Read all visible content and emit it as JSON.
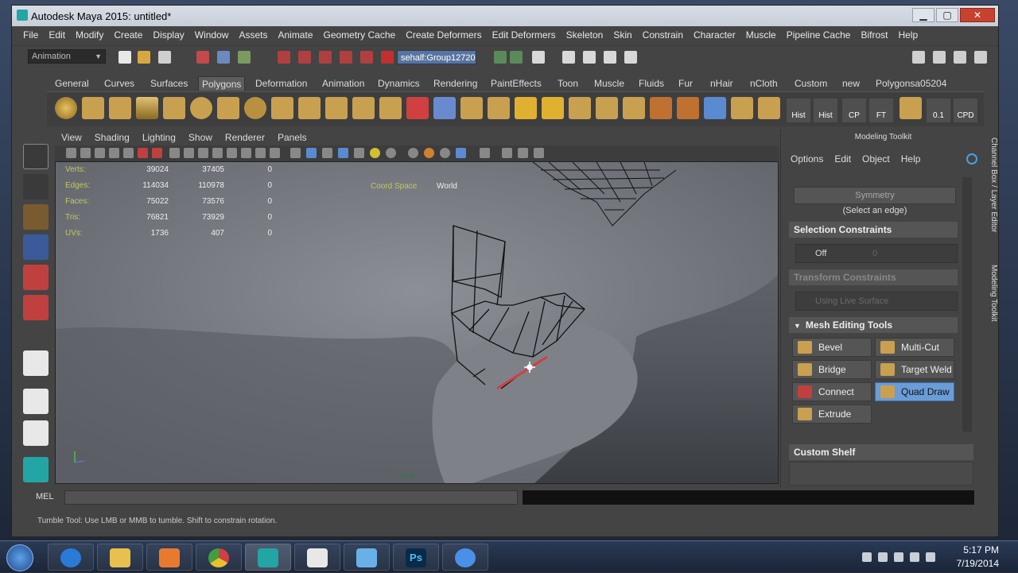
{
  "window": {
    "title": "Autodesk Maya 2015: untitled*",
    "min_label": "▁",
    "max_label": "▢",
    "close_label": "✕"
  },
  "menubar": [
    "File",
    "Edit",
    "Modify",
    "Create",
    "Display",
    "Window",
    "Assets",
    "Animate",
    "Geometry Cache",
    "Create Deformers",
    "Edit Deformers",
    "Skeleton",
    "Skin",
    "Constrain",
    "Character",
    "Muscle",
    "Pipeline Cache",
    "Bifrost",
    "Help"
  ],
  "statusline": {
    "mode": "Animation",
    "selection_field": "sehalf:Group12720"
  },
  "shelf_tabs": [
    "General",
    "Curves",
    "Surfaces",
    "Polygons",
    "Deformation",
    "Animation",
    "Dynamics",
    "Rendering",
    "PaintEffects",
    "Toon",
    "Muscle",
    "Fluids",
    "Fur",
    "nHair",
    "nCloth",
    "Custom",
    "new",
    "Polygonsa05204"
  ],
  "active_shelf_tab": "Polygons",
  "shelf_labels": [
    "Hist",
    "Hist",
    "CP",
    "FT",
    "0.1",
    "CPD"
  ],
  "panel_menu": [
    "View",
    "Shading",
    "Lighting",
    "Show",
    "Renderer",
    "Panels"
  ],
  "hud": {
    "rows": [
      {
        "label": "Verts:",
        "v1": "39024",
        "v2": "37405",
        "v3": "0"
      },
      {
        "label": "Edges:",
        "v1": "114034",
        "v2": "110978",
        "v3": "0"
      },
      {
        "label": "Faces:",
        "v1": "75022",
        "v2": "73576",
        "v3": "0"
      },
      {
        "label": "Tris:",
        "v1": "76821",
        "v2": "73929",
        "v3": "0"
      },
      {
        "label": "UVs:",
        "v1": "1736",
        "v2": "407",
        "v3": "0"
      }
    ],
    "coord_space_label": "Coord Space",
    "coord_space_value": "World",
    "fps": "000.00"
  },
  "toolkit": {
    "title": "Modeling Toolkit",
    "menu": [
      "Options",
      "Edit",
      "Object",
      "Help"
    ],
    "symmetry_button": "Symmetry",
    "symmetry_hint": "(Select an edge)",
    "selection_constraints": "Selection Constraints",
    "selection_constraints_value": "Off",
    "selection_constraints_num": "0",
    "transform_constraints": "Transform Constraints",
    "transform_constraints_value": "Using Live Surface",
    "mesh_editing_tools": "Mesh Editing Tools",
    "tools": [
      "Bevel",
      "Multi-Cut",
      "Bridge",
      "Target Weld",
      "Connect",
      "Quad Draw",
      "Extrude"
    ],
    "active_tool": "Quad Draw",
    "custom_shelf": "Custom Shelf"
  },
  "side_tabs": [
    "Channel Box / Layer Editor",
    "Modeling Toolkit"
  ],
  "cmdline": {
    "label": "MEL"
  },
  "helpline": "Tumble Tool: Use LMB or MMB to tumble. Shift to constrain rotation.",
  "taskbar": {
    "time": "5:17 PM",
    "date": "7/19/2014",
    "apps": [
      "ie-icon",
      "explorer-icon",
      "media-player-icon",
      "chrome-icon",
      "maya-icon",
      "zbrush-icon",
      "photos-icon",
      "photoshop-icon",
      "settings-icon"
    ]
  },
  "colors": {
    "accent": "#6a9cd8",
    "hud_label": "#c2c95a",
    "selection_field": "#5874a0"
  }
}
